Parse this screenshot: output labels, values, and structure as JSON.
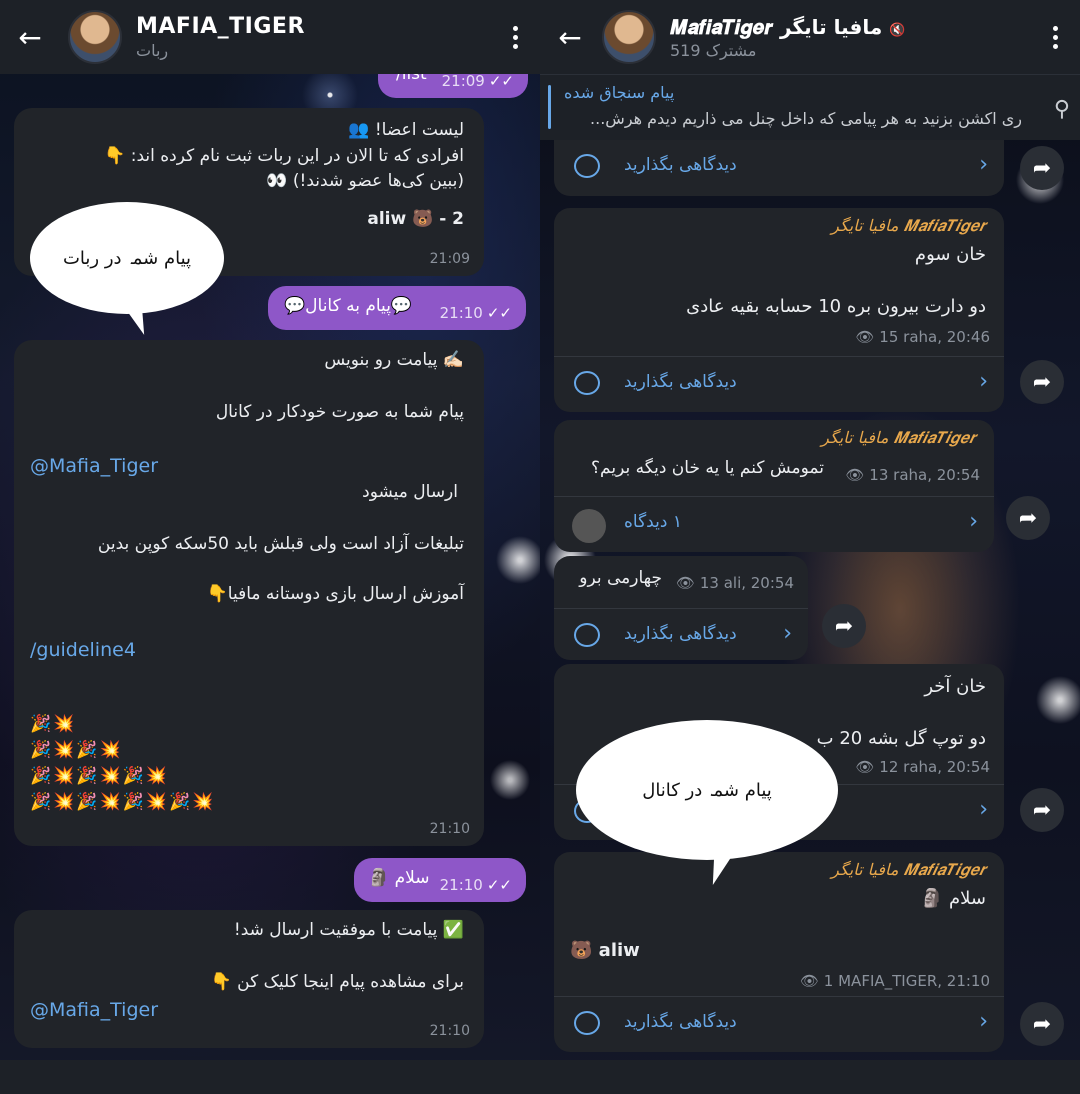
{
  "left": {
    "header": {
      "back_icon": "←",
      "title": "MAFIA_TIGER",
      "subtitle": "ربات"
    },
    "msgs": {
      "list_cmd": "/list",
      "list_time": "21:09",
      "list_title": "لیست اعضا! 👥",
      "list_line2": "افرادی که تا الان در این ربات ثبت نام کرده اند: 👇",
      "list_line3": "(ببین کی‌ها عضو شدند!) 👀",
      "list_member": "aliw 🐻 - 2",
      "list_member_time": "21:09",
      "to_channel": "💬پیام به کانال💬",
      "to_channel_time": "21:10",
      "write_line": "✍🏻 پیامت رو بنویس",
      "auto_line": "پیام شما به صورت خودکار در کانال",
      "channel_link": "@Mafia_Tiger",
      "sent_line": "ارسال میشود",
      "ads_line": "تبلیغات آزاد است ولی قبلش باید 50سکه کوپن بدین",
      "learn_line": "آموزش ارسال بازی دوستانه مافیا👇",
      "guideline": "/guideline4",
      "emoji_row1": "🎉💥",
      "emoji_row2": "🎉💥🎉💥",
      "emoji_row3": "🎉💥🎉💥🎉💥",
      "emoji_row4": "🎉💥🎉💥🎉💥🎉💥",
      "write_time": "21:10",
      "salam": "سلام 🗿",
      "salam_time": "21:10",
      "success_line": "✅ پیامت با موفقیت ارسال شد!",
      "click_line": "برای مشاهده پیام اینجا کلیک کن 👇",
      "success_link": "@Mafia_Tiger",
      "success_time": "21:10"
    },
    "speech": "پیام شما در ربات"
  },
  "right": {
    "header": {
      "title": "𝑴𝒂𝒇𝒊𝒂𝑻𝒊𝒈𝒆𝒓 مافیا تایگر",
      "subtitle": "519 مشترک",
      "muted_icon": "🔇"
    },
    "pinned": {
      "title": "پیام سنجاق شده",
      "text": "ری اکشن بزنید به هر پیامی که داخل چنل می ذاریم  دیدم هرش..."
    },
    "comment_label": "دیدگاهی بگذارید",
    "sender": "𝑴𝒂𝒇𝒊𝒂𝑻𝒊𝒈𝒆𝒓 مافیا تایگر",
    "posts": [
      {
        "line1": "خان سوم",
        "line2": "دو دارت بیرون بره 10 حسابه بقیه عادی",
        "views": "15",
        "meta": "raha, 20:46"
      },
      {
        "line1": "تمومش کنم یا یه خان دیگه بریم؟",
        "views": "13",
        "meta": "raha, 20:54",
        "comments": "۱ دیدگاه"
      },
      {
        "line1": "چهارمی برو",
        "views": "13",
        "meta": "ali, 20:54"
      },
      {
        "line1": "خان آخر",
        "line2": "دو توپ گل بشه 20 ب",
        "views": "12",
        "meta": "raha, 20:54"
      },
      {
        "line1": "سلام 🗿",
        "line2": "🐻 aliw",
        "views": "1",
        "meta": "MAFIA_TIGER, 21:10"
      }
    ],
    "speech": "پیام شما در کانال"
  },
  "icons": {
    "share": "share-icon",
    "comment": "comment-bubble-icon",
    "chevron": "chevron-right-icon",
    "eye": "eye-icon",
    "pin": "pin-icon"
  }
}
